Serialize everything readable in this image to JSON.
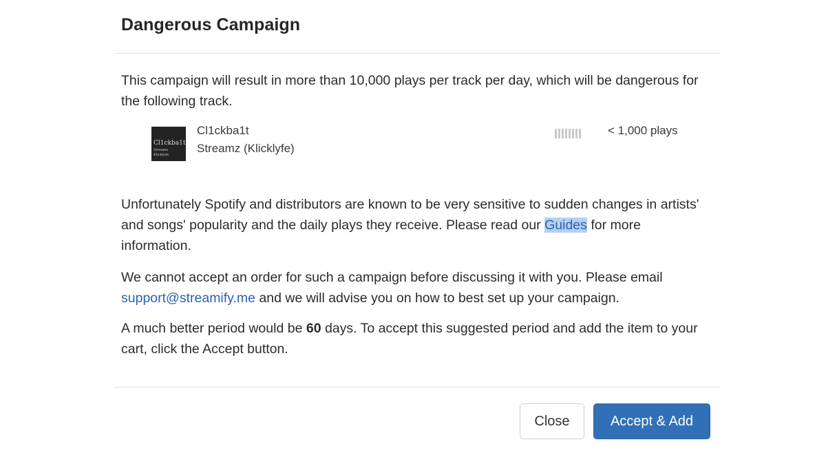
{
  "modal": {
    "title": "Dangerous Campaign",
    "intro": "This campaign will result in more than 10,000 plays per track per day, which will be dangerous for the following track.",
    "track": {
      "cover_line1": "Cl1ckba1t",
      "cover_line2": "Streamz",
      "cover_line3": "Klicklyfe",
      "title": "Cl1ckba1t",
      "artist": "Streamz (Klicklyfe)",
      "plays": "< 1,000 plays"
    },
    "warning": {
      "text_before": "Unfortunately Spotify and distributors are known to be very sensitive to sudden changes in artists' and songs' popularity and the daily plays they receive. Please read our ",
      "guides_link": "Guides",
      "text_after": " for more information."
    },
    "contact": {
      "text_before": "We cannot accept an order for such a campaign before discussing it with you. Please email ",
      "email_link": "support@streamify.me",
      "text_after": " and we will advise you on how to best set up your campaign."
    },
    "suggestion": {
      "text_before": "A much better period would be ",
      "days": "60",
      "text_after": " days. To accept this suggested period and add the item to your cart, click the Accept button."
    },
    "buttons": {
      "close": "Close",
      "accept": "Accept & Add"
    }
  },
  "colors": {
    "link": "#2a62b3",
    "selection": "#b5d1f2",
    "primary_button": "#3170b7",
    "divider": "#e3e3e3"
  },
  "icons": {
    "popularity_meter": "popularity-bars-icon"
  }
}
